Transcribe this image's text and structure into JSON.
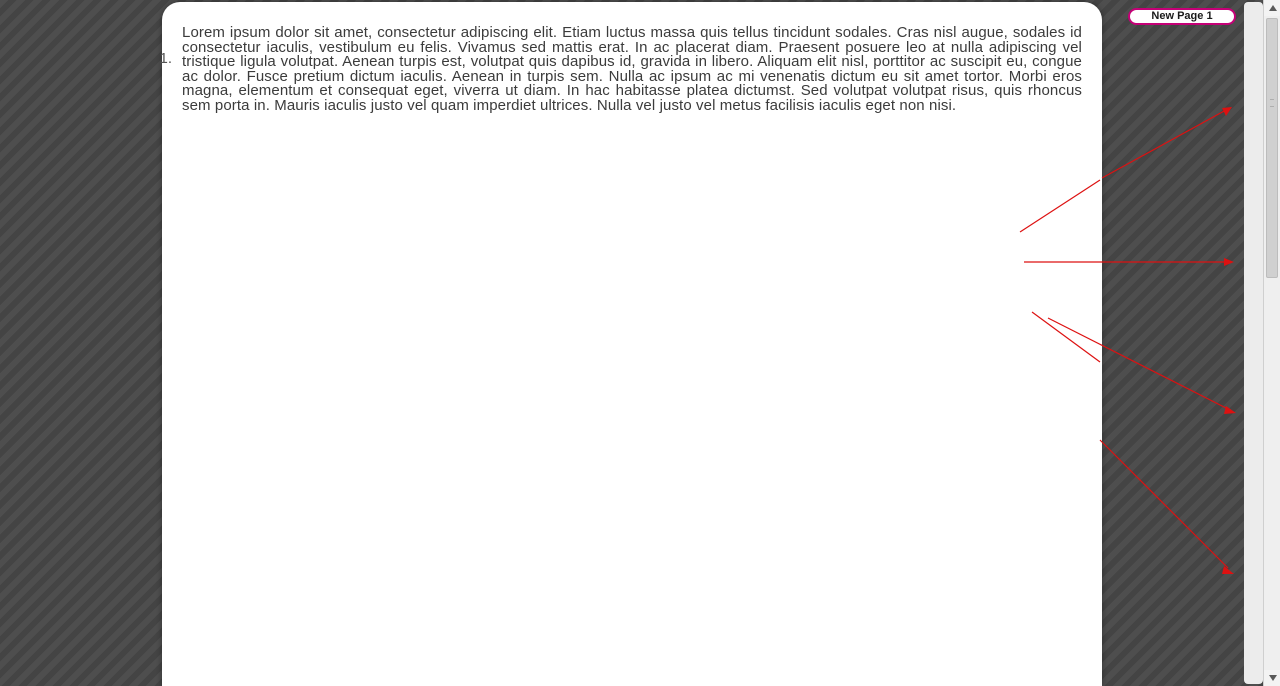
{
  "document": {
    "list_number": "1.",
    "body_text": "Lorem ipsum dolor sit amet, consectetur adipiscing elit. Etiam luctus massa quis tellus tincidunt sodales. Cras nisl augue, sodales id consectetur iaculis, vestibulum eu felis. Vivamus sed mattis erat. In ac placerat diam. Praesent posuere leo at nulla adipiscing vel tristique ligula volutpat. Aenean turpis est, volutpat quis dapibus id, gravida in libero. Aliquam elit nisl, porttitor ac suscipit eu, congue ac dolor. Fusce pretium dictum iaculis. Aenean in turpis sem. Nulla ac ipsum ac mi venenatis dictum eu sit amet tortor. Morbi eros magna, elementum et consequat eget, viverra ut diam. In hac habitasse platea dictumst. Sed volutpat volutpat risus, quis rhoncus sem porta in. Mauris iaculis justo vel quam imperdiet ultrices. Nulla vel justo vel metus facilisis iaculis eget non nisi."
  },
  "buttons": {
    "new_page": "New Page 1"
  }
}
